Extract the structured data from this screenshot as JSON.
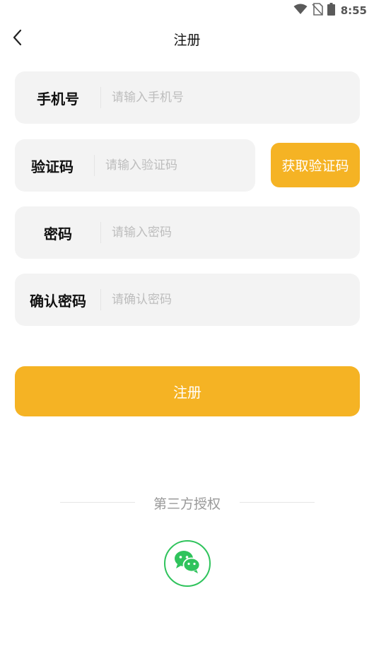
{
  "status_bar": {
    "time": "8:55",
    "icons": [
      "wifi-icon",
      "no-sim-icon",
      "battery-icon"
    ]
  },
  "header": {
    "title": "注册",
    "back_icon": "chevron-left-icon"
  },
  "form": {
    "phone": {
      "label": "手机号",
      "placeholder": "请输入手机号"
    },
    "code": {
      "label": "验证码",
      "placeholder": "请输入验证码",
      "button_label": "获取验证码"
    },
    "password": {
      "label": "密码",
      "placeholder": "请输入密码"
    },
    "confirm": {
      "label": "确认密码",
      "placeholder": "请确认密码"
    }
  },
  "register_button": {
    "label": "注册"
  },
  "third_party": {
    "title": "第三方授权",
    "providers": [
      {
        "icon": "wechat-icon"
      }
    ]
  },
  "colors": {
    "accent": "#f5b324",
    "field_background": "#f3f3f3",
    "wechat_green": "#2fc35c",
    "placeholder": "#bdbdbd"
  }
}
